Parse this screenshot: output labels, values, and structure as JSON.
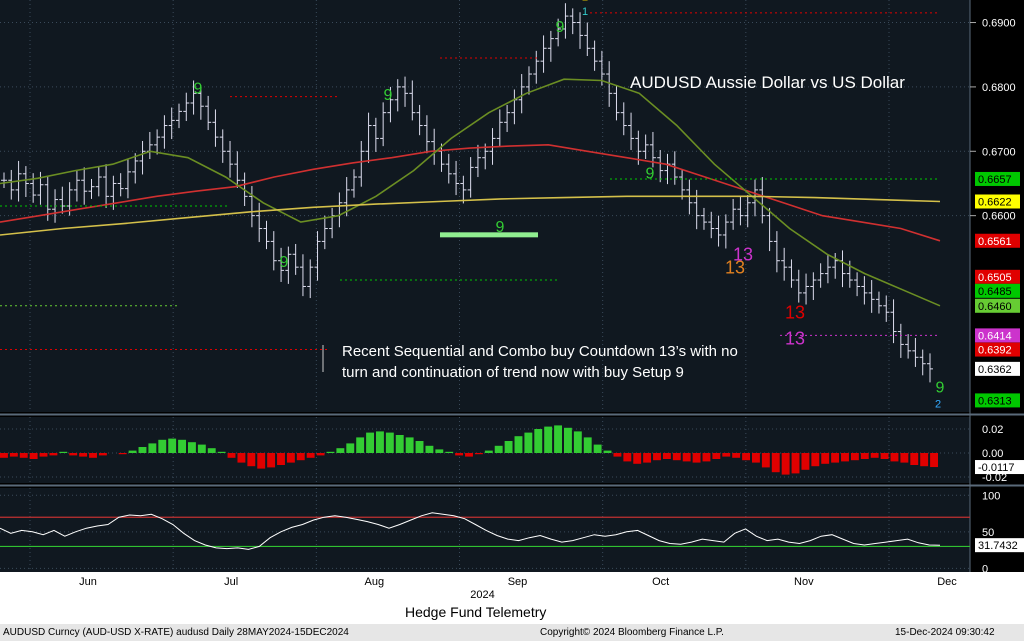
{
  "chart_data": {
    "type": "candlestick",
    "title": "AUDUSD Aussie Dollar vs US Dollar",
    "annotation": "Recent Sequential and Combo buy Countdown 13’s with no turn and continuation of trend now with buy Setup 9",
    "x_year_label": "2024",
    "x_months": [
      "Jun",
      "Jul",
      "Aug",
      "Sep",
      "Oct",
      "Nov",
      "Dec"
    ],
    "price_axis": {
      "ylim": [
        0.6295,
        0.6935
      ],
      "ticks": [
        "0.6900",
        "0.6800",
        "0.6700",
        "0.6600"
      ],
      "tick_values": [
        0.69,
        0.68,
        0.67,
        0.66
      ]
    },
    "last_value_tags": [
      {
        "value": 0.6657,
        "text": "0.6657",
        "color": "#00c800"
      },
      {
        "value": 0.6622,
        "text": "0.6622",
        "color": "#ffff00"
      },
      {
        "value": 0.6561,
        "text": "0.6561",
        "color": "#e00000"
      },
      {
        "value": 0.6505,
        "text": "0.6505",
        "color": "#e00000"
      },
      {
        "value": 0.6485,
        "text": "0.6485",
        "color": "#00c800"
      },
      {
        "value": 0.646,
        "text": "0.6460",
        "color": "#66cc33"
      },
      {
        "value": 0.6414,
        "text": "0.6414",
        "color": "#cc33cc"
      },
      {
        "value": 0.6392,
        "text": "0.6392",
        "color": "#e00000"
      },
      {
        "value": 0.6362,
        "text": "0.6362",
        "color": "#ffffff"
      },
      {
        "value": 0.6313,
        "text": "0.6313",
        "color": "#00c800"
      }
    ],
    "series": [
      {
        "name": "price_close",
        "color": "#ffffff",
        "values": [
          0.6655,
          0.664,
          0.6665,
          0.665,
          0.6632,
          0.6648,
          0.661,
          0.6625,
          0.6615,
          0.664,
          0.6655,
          0.6638,
          0.6645,
          0.666,
          0.663,
          0.665,
          0.6642,
          0.6668,
          0.6685,
          0.67,
          0.671,
          0.6722,
          0.674,
          0.6748,
          0.6762,
          0.6775,
          0.679,
          0.677,
          0.6745,
          0.6722,
          0.67,
          0.668,
          0.6655,
          0.663,
          0.66,
          0.658,
          0.656,
          0.653,
          0.6515,
          0.654,
          0.652,
          0.649,
          0.652,
          0.656,
          0.658,
          0.66,
          0.662,
          0.664,
          0.666,
          0.67,
          0.674,
          0.672,
          0.676,
          0.678,
          0.68,
          0.679,
          0.676,
          0.674,
          0.6715,
          0.67,
          0.668,
          0.6665,
          0.665,
          0.664,
          0.6675,
          0.669,
          0.67,
          0.672,
          0.6745,
          0.676,
          0.678,
          0.68,
          0.682,
          0.684,
          0.686,
          0.6875,
          0.689,
          0.691,
          0.69,
          0.688,
          0.686,
          0.684,
          0.682,
          0.679,
          0.676,
          0.674,
          0.672,
          0.67,
          0.671,
          0.669,
          0.667,
          0.668,
          0.666,
          0.664,
          0.662,
          0.66,
          0.659,
          0.658,
          0.657,
          0.659,
          0.661,
          0.66,
          0.662,
          0.664,
          0.66,
          0.656,
          0.653,
          0.652,
          0.65,
          0.648,
          0.649,
          0.65,
          0.651,
          0.652,
          0.653,
          0.651,
          0.65,
          0.649,
          0.648,
          0.647,
          0.646,
          0.645,
          0.642,
          0.64,
          0.639,
          0.638,
          0.637,
          0.6362
        ]
      },
      {
        "name": "ma_red",
        "color": "#d03030",
        "values": [
          0.659,
          0.66,
          0.661,
          0.662,
          0.663,
          0.6638,
          0.6645,
          0.666,
          0.6672,
          0.6682,
          0.669,
          0.67,
          0.6705,
          0.6708,
          0.671,
          0.67,
          0.669,
          0.668,
          0.666,
          0.664,
          0.662,
          0.66,
          0.659,
          0.658,
          0.6561
        ]
      },
      {
        "name": "ma_olive",
        "color": "#6b8e23",
        "values": [
          0.665,
          0.6658,
          0.667,
          0.668,
          0.67,
          0.669,
          0.666,
          0.662,
          0.659,
          0.66,
          0.663,
          0.667,
          0.672,
          0.676,
          0.679,
          0.6812,
          0.681,
          0.679,
          0.674,
          0.668,
          0.663,
          0.658,
          0.654,
          0.651,
          0.6485,
          0.646
        ]
      },
      {
        "name": "ma_yellow",
        "color": "#d4c04a",
        "values": [
          0.657,
          0.658,
          0.6588,
          0.6597,
          0.6606,
          0.6613,
          0.6618,
          0.6622,
          0.6626,
          0.6628,
          0.663,
          0.663,
          0.663,
          0.6628,
          0.6625,
          0.6622
        ]
      }
    ],
    "setup_labels": [
      {
        "text": "9",
        "color": "#33cc33"
      },
      {
        "text": "9",
        "color": "#33cc33"
      },
      {
        "text": "9",
        "color": "#33cc33"
      },
      {
        "text": "9",
        "color": "#33cc33"
      },
      {
        "text": "9",
        "color": "#33cc33"
      },
      {
        "text": "9",
        "color": "#33cc33"
      },
      {
        "text": "9",
        "color": "#33cc33"
      },
      {
        "text": "13",
        "color": "#e08020"
      },
      {
        "text": "13",
        "color": "#cc33cc"
      },
      {
        "text": "13",
        "color": "#e00000"
      },
      {
        "text": "13",
        "color": "#cc33cc"
      },
      {
        "text": "2",
        "color": "#e0c000"
      },
      {
        "text": "1",
        "color": "#33cccc"
      },
      {
        "text": "2",
        "color": "#33aaff"
      }
    ],
    "oscillator_1": {
      "ylim": [
        -0.025,
        0.03
      ],
      "ticks": [
        "0.02",
        "0.00",
        "-0.02"
      ],
      "tick_values": [
        0.02,
        0.0,
        -0.02
      ],
      "last_tag": "-0.0117",
      "last_value": -0.0117,
      "positive_color": "#33cc33",
      "negative_color": "#e00000",
      "values": [
        -0.004,
        -0.003,
        -0.004,
        -0.005,
        -0.003,
        -0.002,
        0.001,
        -0.002,
        -0.003,
        -0.004,
        -0.002,
        0.0,
        -0.001,
        0.002,
        0.005,
        0.008,
        0.011,
        0.012,
        0.011,
        0.009,
        0.007,
        0.004,
        0.001,
        -0.004,
        -0.008,
        -0.011,
        -0.013,
        -0.012,
        -0.01,
        -0.008,
        -0.006,
        -0.004,
        -0.002,
        0.001,
        0.004,
        0.008,
        0.013,
        0.017,
        0.018,
        0.017,
        0.015,
        0.013,
        0.01,
        0.006,
        0.003,
        0.001,
        -0.002,
        -0.003,
        -0.001,
        0.002,
        0.006,
        0.01,
        0.014,
        0.017,
        0.02,
        0.022,
        0.023,
        0.021,
        0.018,
        0.013,
        0.007,
        0.002,
        -0.003,
        -0.007,
        -0.009,
        -0.008,
        -0.006,
        -0.005,
        -0.006,
        -0.007,
        -0.008,
        -0.007,
        -0.005,
        -0.003,
        -0.004,
        -0.006,
        -0.008,
        -0.012,
        -0.016,
        -0.018,
        -0.017,
        -0.014,
        -0.011,
        -0.009,
        -0.008,
        -0.007,
        -0.006,
        -0.005,
        -0.004,
        -0.005,
        -0.007,
        -0.008,
        -0.01,
        -0.011,
        -0.0117
      ]
    },
    "oscillator_2": {
      "ylim": [
        -5,
        110
      ],
      "ticks": [
        "100",
        "50",
        "0"
      ],
      "tick_values": [
        100,
        50,
        0
      ],
      "upper_band": 70,
      "lower_band": 30,
      "last_tag": "31.7432",
      "last_value": 31.7432,
      "line_color": "#ffffff",
      "values": [
        55,
        48,
        52,
        50,
        46,
        52,
        44,
        50,
        55,
        58,
        60,
        70,
        73,
        72,
        74,
        68,
        60,
        48,
        38,
        32,
        28,
        27,
        28,
        26,
        30,
        42,
        50,
        56,
        60,
        66,
        70,
        72,
        70,
        67,
        64,
        60,
        55,
        60,
        66,
        72,
        76,
        74,
        72,
        68,
        60,
        52,
        45,
        40,
        38,
        42,
        45,
        40,
        36,
        38,
        42,
        46,
        44,
        46,
        50,
        52,
        45,
        38,
        34,
        33,
        36,
        40,
        38,
        36,
        48,
        54,
        44,
        38,
        40,
        36,
        34,
        38,
        44,
        46,
        40,
        34,
        32,
        34,
        36,
        38,
        40,
        35,
        32,
        31.7432
      ]
    }
  },
  "footer": {
    "caption": "Hedge Fund Telemetry",
    "left": "AUDUSD Curncy (AUD-USD X-RATE) audusd  Daily 28MAY2024-15DEC2024",
    "center": "Copyright© 2024 Bloomberg Finance L.P.",
    "right": "15-Dec-2024 09:30:42"
  },
  "colors": {
    "background": "#000000",
    "panel_bg": "#101820",
    "grid": "#3a4a5a",
    "axis_text": "#ffffff"
  }
}
